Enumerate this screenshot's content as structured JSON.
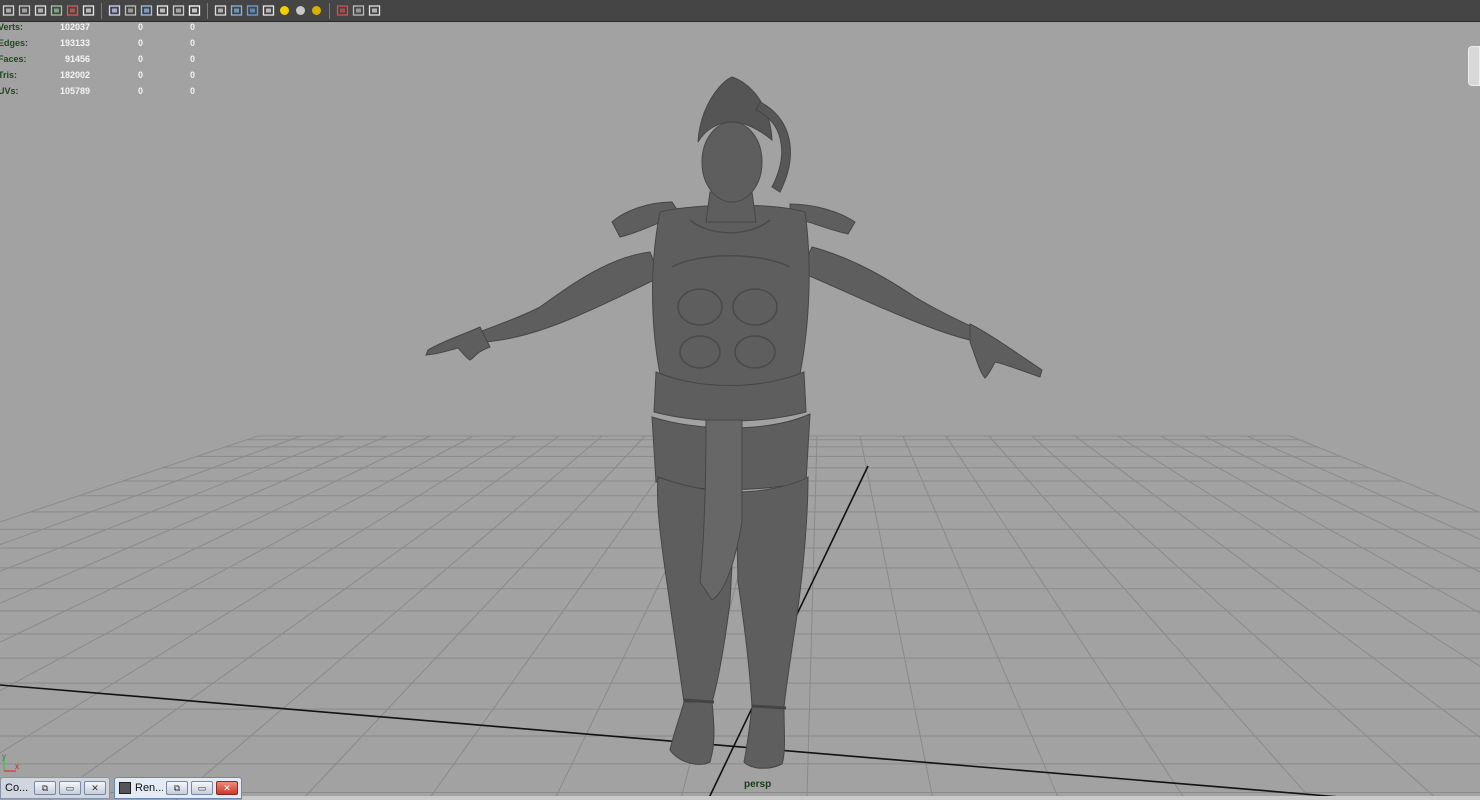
{
  "toolbar": {
    "icons": [
      "select-tool-icon",
      "lasso-icon",
      "graph-icon",
      "paint-icon",
      "snap-icon",
      "camera-icon",
      "film-icon",
      "image-plane-icon",
      "gate-icon",
      "resolution-icon",
      "grid-toggle-icon",
      "texture-icon",
      "wireframe-cube-icon",
      "smooth-cube-icon",
      "shaded-cube-icon",
      "checker-icon",
      "light-default-icon",
      "light-all-icon",
      "light-none-icon",
      "isolate-select-icon",
      "xray-icon",
      "joints-icon"
    ]
  },
  "hud": {
    "rows": [
      {
        "label": "Verts:",
        "v1": "102037",
        "v2": "0",
        "v3": "0"
      },
      {
        "label": "Edges:",
        "v1": "193133",
        "v2": "0",
        "v3": "0"
      },
      {
        "label": "Faces:",
        "v1": "91456",
        "v2": "0",
        "v3": "0"
      },
      {
        "label": "Tris:",
        "v1": "182002",
        "v2": "0",
        "v3": "0"
      },
      {
        "label": "UVs:",
        "v1": "105789",
        "v2": "0",
        "v3": "0"
      }
    ]
  },
  "viewport": {
    "camera_label": "persp",
    "background_color": "#a2a2a2",
    "grid_color": "#8a8a8a",
    "model_color": "#5c5c5c"
  },
  "taskbar": {
    "window1_label": "Co...",
    "window2_label": "Ren..."
  },
  "axis": {
    "y": "y",
    "x": "x"
  }
}
